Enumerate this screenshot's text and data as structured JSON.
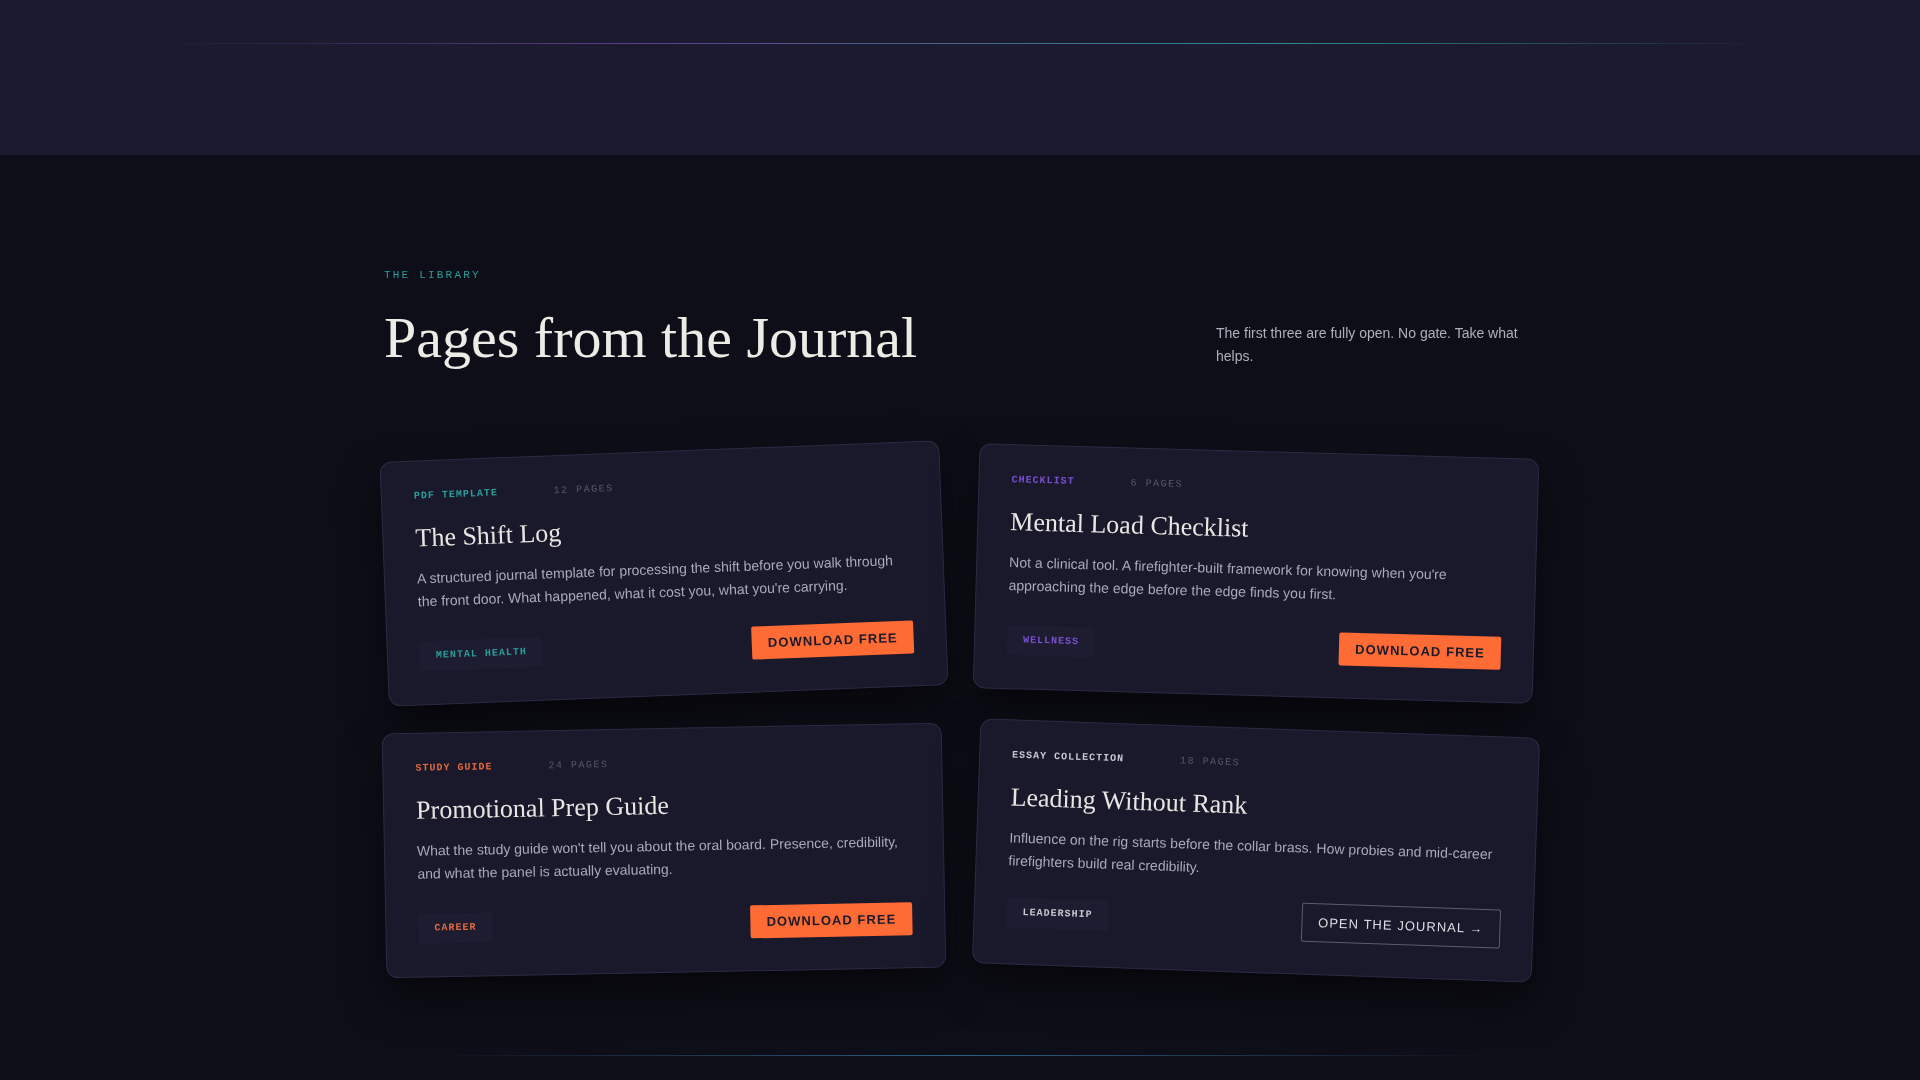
{
  "section": {
    "eyebrow": "THE LIBRARY",
    "title": "Pages from the Journal",
    "intro": "The first three are fully open. No gate. Take what helps."
  },
  "resources": [
    {
      "type": "PDF TEMPLATE",
      "pages": "12 PAGES",
      "title": "The Shift Log",
      "description": "A structured journal template for processing the shift before you walk through the front door. What happened, what it cost you, what you're carrying.",
      "tag": "MENTAL HEALTH",
      "color": "#2a9d9a",
      "action": {
        "kind": "download",
        "label": "DOWNLOAD FREE"
      }
    },
    {
      "type": "CHECKLIST",
      "pages": "6 PAGES",
      "title": "Mental Load Checklist",
      "description": "Not a clinical tool. A firefighter-built framework for knowing when you're approaching the edge before the edge finds you first.",
      "tag": "WELLNESS",
      "color": "#7b4fd4",
      "action": {
        "kind": "download",
        "label": "DOWNLOAD FREE"
      }
    },
    {
      "type": "STUDY GUIDE",
      "pages": "24 PAGES",
      "title": "Promotional Prep Guide",
      "description": "What the study guide won't tell you about the oral board. Presence, credibility, and what the panel is actually evaluating.",
      "tag": "CAREER",
      "color": "#e0683c",
      "action": {
        "kind": "download",
        "label": "DOWNLOAD FREE"
      }
    },
    {
      "type": "ESSAY COLLECTION",
      "pages": "18 PAGES",
      "title": "Leading Without Rank",
      "description": "Influence on the rig starts before the collar brass. How probies and mid-career firefighters build real credibility.",
      "tag": "LEADERSHIP",
      "color": "#c8c8d2",
      "action": {
        "kind": "link",
        "label": "OPEN THE JOURNAL →"
      }
    }
  ]
}
